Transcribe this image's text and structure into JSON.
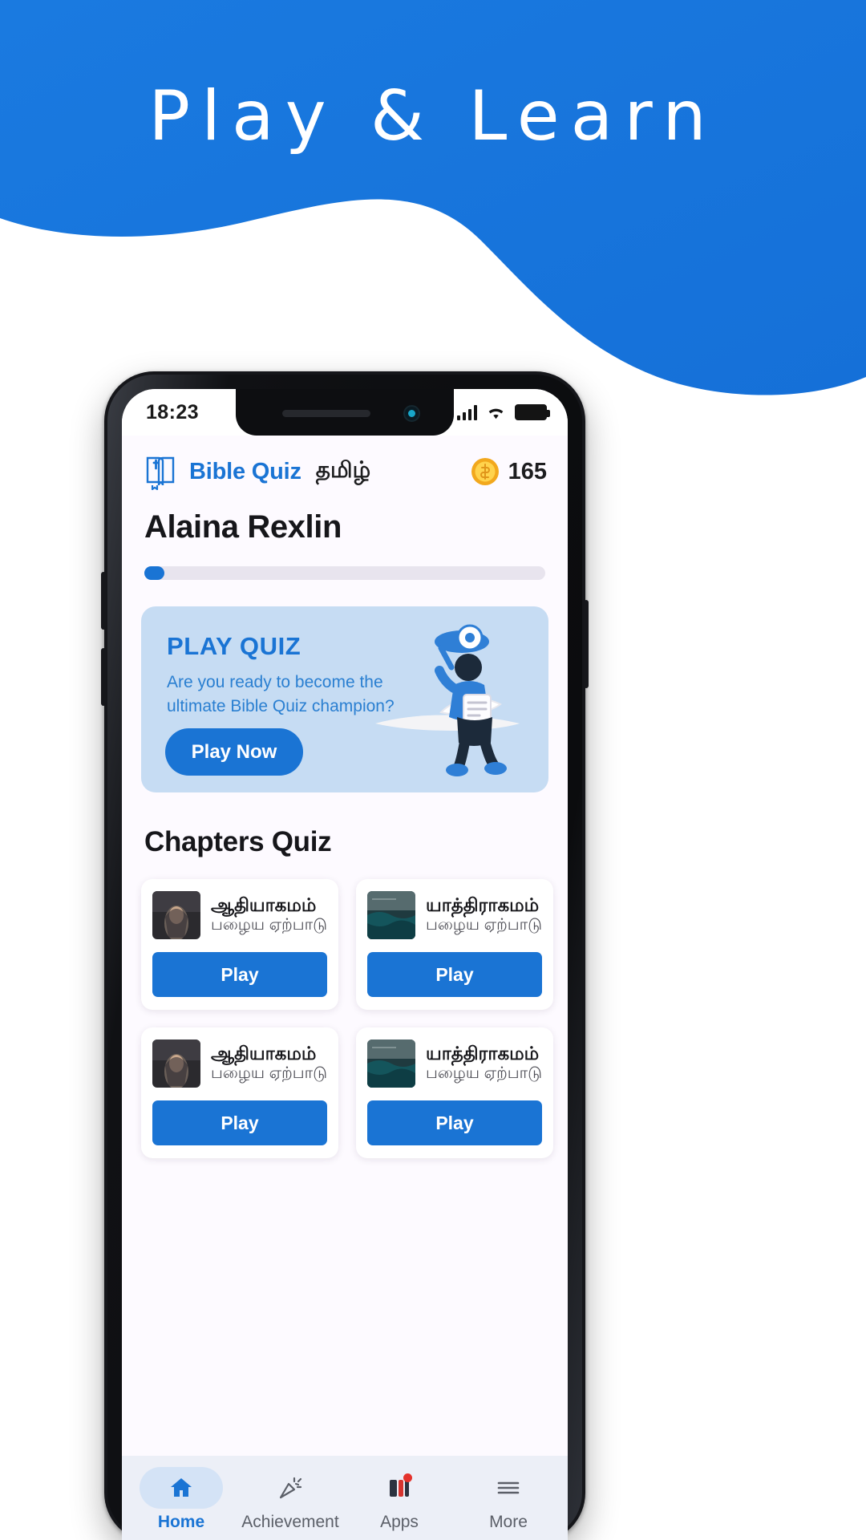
{
  "promo": {
    "headline": "Play & Learn",
    "background_color": "#1a7ae0",
    "page_background": "#ffffff"
  },
  "phone": {
    "status_bar": {
      "time": "18:23",
      "signal_icon": "cellular-signal-icon",
      "wifi_icon": "wifi-icon",
      "battery_icon": "battery-full-icon"
    }
  },
  "app": {
    "header": {
      "logo_icon": "bible-book-icon",
      "brand_name": "Bible Quiz",
      "brand_language": "தமிழ்",
      "coin_icon": "coin-icon",
      "coin_count": "165"
    },
    "user": {
      "name": "Alaina Rexlin",
      "progress_percent": 4
    },
    "play_quiz_card": {
      "title": "PLAY QUIZ",
      "subtitle": "Are you ready to become the ultimate Bible Quiz champion?",
      "button_label": "Play Now",
      "illustration": "person-with-quiz-illustration",
      "background_color": "#c6dcf3",
      "accent_color": "#1a74d4"
    },
    "chapters_section": {
      "title": "Chapters Quiz",
      "cards": [
        {
          "name": "ஆதியாகமம்",
          "testament": "பழைய ஏற்பாடு",
          "thumb": "genesis-thumbnail",
          "play_label": "Play"
        },
        {
          "name": "யாத்திராகமம்",
          "testament": "பழைய ஏற்பாடு",
          "thumb": "exodus-thumbnail",
          "play_label": "Play"
        },
        {
          "name": "ஆதியாகமம்",
          "testament": "பழைய ஏற்பாடு",
          "thumb": "genesis-thumbnail",
          "play_label": "Play"
        },
        {
          "name": "யாத்திராகமம்",
          "testament": "பழைய ஏற்பாடு",
          "thumb": "exodus-thumbnail",
          "play_label": "Play"
        }
      ]
    },
    "bottom_nav": {
      "items": [
        {
          "label": "Home",
          "icon": "home-icon",
          "active": true
        },
        {
          "label": "Achievement",
          "icon": "confetti-icon",
          "active": false
        },
        {
          "label": "Apps",
          "icon": "apps-icon",
          "active": false,
          "badge": true
        },
        {
          "label": "More",
          "icon": "hamburger-menu-icon",
          "active": false
        }
      ]
    }
  }
}
